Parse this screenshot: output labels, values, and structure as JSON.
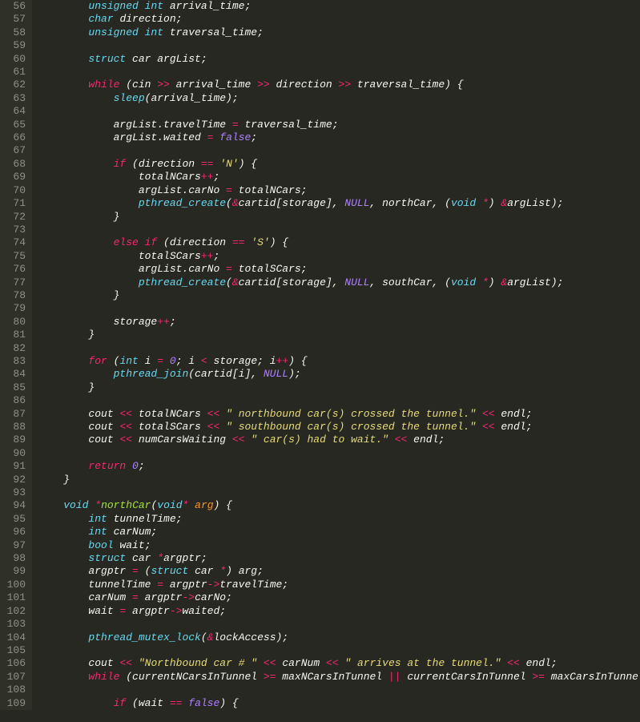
{
  "startLine": 56,
  "lines": [
    {
      "indent": 2,
      "tokens": [
        [
          "type",
          "unsigned int"
        ],
        [
          "plain",
          " arrival_time;"
        ]
      ]
    },
    {
      "indent": 2,
      "tokens": [
        [
          "type",
          "char"
        ],
        [
          "plain",
          " direction;"
        ]
      ]
    },
    {
      "indent": 2,
      "tokens": [
        [
          "type",
          "unsigned int"
        ],
        [
          "plain",
          " traversal_time;"
        ]
      ]
    },
    {
      "indent": 0,
      "tokens": []
    },
    {
      "indent": 2,
      "tokens": [
        [
          "type",
          "struct"
        ],
        [
          "plain",
          " car argList;"
        ]
      ]
    },
    {
      "indent": 0,
      "tokens": []
    },
    {
      "indent": 2,
      "tokens": [
        [
          "kw",
          "while"
        ],
        [
          "plain",
          " (cin "
        ],
        [
          "op",
          ">>"
        ],
        [
          "plain",
          " arrival_time "
        ],
        [
          "op",
          ">>"
        ],
        [
          "plain",
          " direction "
        ],
        [
          "op",
          ">>"
        ],
        [
          "plain",
          " traversal_time) {"
        ]
      ]
    },
    {
      "indent": 3,
      "tokens": [
        [
          "func",
          "sleep"
        ],
        [
          "plain",
          "(arrival_time);"
        ]
      ]
    },
    {
      "indent": 0,
      "tokens": []
    },
    {
      "indent": 3,
      "tokens": [
        [
          "plain",
          "argList.travelTime "
        ],
        [
          "op",
          "="
        ],
        [
          "plain",
          " traversal_time;"
        ]
      ]
    },
    {
      "indent": 3,
      "tokens": [
        [
          "plain",
          "argList.waited "
        ],
        [
          "op",
          "="
        ],
        [
          "plain",
          " "
        ],
        [
          "num",
          "false"
        ],
        [
          "plain",
          ";"
        ]
      ]
    },
    {
      "indent": 0,
      "tokens": []
    },
    {
      "indent": 3,
      "tokens": [
        [
          "kw",
          "if"
        ],
        [
          "plain",
          " (direction "
        ],
        [
          "op",
          "=="
        ],
        [
          "plain",
          " "
        ],
        [
          "str",
          "'N'"
        ],
        [
          "plain",
          ") {"
        ]
      ]
    },
    {
      "indent": 4,
      "tokens": [
        [
          "plain",
          "totalNCars"
        ],
        [
          "op",
          "++"
        ],
        [
          "plain",
          ";"
        ]
      ]
    },
    {
      "indent": 4,
      "tokens": [
        [
          "plain",
          "argList.carNo "
        ],
        [
          "op",
          "="
        ],
        [
          "plain",
          " totalNCars;"
        ]
      ]
    },
    {
      "indent": 4,
      "tokens": [
        [
          "func",
          "pthread_create"
        ],
        [
          "plain",
          "("
        ],
        [
          "op",
          "&"
        ],
        [
          "plain",
          "cartid[storage], "
        ],
        [
          "num",
          "NULL"
        ],
        [
          "plain",
          ", northCar, ("
        ],
        [
          "type",
          "void"
        ],
        [
          "plain",
          " "
        ],
        [
          "op",
          "*"
        ],
        [
          "plain",
          ") "
        ],
        [
          "op",
          "&"
        ],
        [
          "plain",
          "argList);"
        ]
      ]
    },
    {
      "indent": 3,
      "tokens": [
        [
          "plain",
          "}"
        ]
      ]
    },
    {
      "indent": 0,
      "tokens": []
    },
    {
      "indent": 3,
      "tokens": [
        [
          "kw",
          "else if"
        ],
        [
          "plain",
          " (direction "
        ],
        [
          "op",
          "=="
        ],
        [
          "plain",
          " "
        ],
        [
          "str",
          "'S'"
        ],
        [
          "plain",
          ") {"
        ]
      ]
    },
    {
      "indent": 4,
      "tokens": [
        [
          "plain",
          "totalSCars"
        ],
        [
          "op",
          "++"
        ],
        [
          "plain",
          ";"
        ]
      ]
    },
    {
      "indent": 4,
      "tokens": [
        [
          "plain",
          "argList.carNo "
        ],
        [
          "op",
          "="
        ],
        [
          "plain",
          " totalSCars;"
        ]
      ]
    },
    {
      "indent": 4,
      "tokens": [
        [
          "func",
          "pthread_create"
        ],
        [
          "plain",
          "("
        ],
        [
          "op",
          "&"
        ],
        [
          "plain",
          "cartid[storage], "
        ],
        [
          "num",
          "NULL"
        ],
        [
          "plain",
          ", southCar, ("
        ],
        [
          "type",
          "void"
        ],
        [
          "plain",
          " "
        ],
        [
          "op",
          "*"
        ],
        [
          "plain",
          ") "
        ],
        [
          "op",
          "&"
        ],
        [
          "plain",
          "argList);"
        ]
      ]
    },
    {
      "indent": 3,
      "tokens": [
        [
          "plain",
          "}"
        ]
      ]
    },
    {
      "indent": 0,
      "tokens": []
    },
    {
      "indent": 3,
      "tokens": [
        [
          "plain",
          "storage"
        ],
        [
          "op",
          "++"
        ],
        [
          "plain",
          ";"
        ]
      ]
    },
    {
      "indent": 2,
      "tokens": [
        [
          "plain",
          "}"
        ]
      ]
    },
    {
      "indent": 0,
      "tokens": []
    },
    {
      "indent": 2,
      "tokens": [
        [
          "kw",
          "for"
        ],
        [
          "plain",
          " ("
        ],
        [
          "type",
          "int"
        ],
        [
          "plain",
          " i "
        ],
        [
          "op",
          "="
        ],
        [
          "plain",
          " "
        ],
        [
          "num",
          "0"
        ],
        [
          "plain",
          "; i "
        ],
        [
          "op",
          "<"
        ],
        [
          "plain",
          " storage; i"
        ],
        [
          "op",
          "++"
        ],
        [
          "plain",
          ") {"
        ]
      ]
    },
    {
      "indent": 3,
      "tokens": [
        [
          "func",
          "pthread_join"
        ],
        [
          "plain",
          "(cartid[i], "
        ],
        [
          "num",
          "NULL"
        ],
        [
          "plain",
          ");"
        ]
      ]
    },
    {
      "indent": 2,
      "tokens": [
        [
          "plain",
          "}"
        ]
      ]
    },
    {
      "indent": 0,
      "tokens": []
    },
    {
      "indent": 2,
      "tokens": [
        [
          "plain",
          "cout "
        ],
        [
          "op",
          "<<"
        ],
        [
          "plain",
          " totalNCars "
        ],
        [
          "op",
          "<<"
        ],
        [
          "plain",
          " "
        ],
        [
          "str",
          "\" northbound car(s) crossed the tunnel.\""
        ],
        [
          "plain",
          " "
        ],
        [
          "op",
          "<<"
        ],
        [
          "plain",
          " endl;"
        ]
      ]
    },
    {
      "indent": 2,
      "tokens": [
        [
          "plain",
          "cout "
        ],
        [
          "op",
          "<<"
        ],
        [
          "plain",
          " totalSCars "
        ],
        [
          "op",
          "<<"
        ],
        [
          "plain",
          " "
        ],
        [
          "str",
          "\" southbound car(s) crossed the tunnel.\""
        ],
        [
          "plain",
          " "
        ],
        [
          "op",
          "<<"
        ],
        [
          "plain",
          " endl;"
        ]
      ]
    },
    {
      "indent": 2,
      "tokens": [
        [
          "plain",
          "cout "
        ],
        [
          "op",
          "<<"
        ],
        [
          "plain",
          " numCarsWaiting "
        ],
        [
          "op",
          "<<"
        ],
        [
          "plain",
          " "
        ],
        [
          "str",
          "\" car(s) had to wait.\""
        ],
        [
          "plain",
          " "
        ],
        [
          "op",
          "<<"
        ],
        [
          "plain",
          " endl;"
        ]
      ]
    },
    {
      "indent": 0,
      "tokens": []
    },
    {
      "indent": 2,
      "tokens": [
        [
          "kw",
          "return"
        ],
        [
          "plain",
          " "
        ],
        [
          "num",
          "0"
        ],
        [
          "plain",
          ";"
        ]
      ]
    },
    {
      "indent": 1,
      "tokens": [
        [
          "plain",
          "}"
        ]
      ]
    },
    {
      "indent": 0,
      "tokens": []
    },
    {
      "indent": 1,
      "tokens": [
        [
          "type",
          "void"
        ],
        [
          "plain",
          " "
        ],
        [
          "op",
          "*"
        ],
        [
          "fn",
          "northCar"
        ],
        [
          "plain",
          "("
        ],
        [
          "type",
          "void"
        ],
        [
          "op",
          "*"
        ],
        [
          "plain",
          " "
        ],
        [
          "param",
          "arg"
        ],
        [
          "plain",
          ") {"
        ]
      ]
    },
    {
      "indent": 2,
      "tokens": [
        [
          "type",
          "int"
        ],
        [
          "plain",
          " tunnelTime;"
        ]
      ]
    },
    {
      "indent": 2,
      "tokens": [
        [
          "type",
          "int"
        ],
        [
          "plain",
          " carNum;"
        ]
      ]
    },
    {
      "indent": 2,
      "tokens": [
        [
          "type",
          "bool"
        ],
        [
          "plain",
          " wait;"
        ]
      ]
    },
    {
      "indent": 2,
      "tokens": [
        [
          "type",
          "struct"
        ],
        [
          "plain",
          " car "
        ],
        [
          "op",
          "*"
        ],
        [
          "plain",
          "argptr;"
        ]
      ]
    },
    {
      "indent": 2,
      "tokens": [
        [
          "plain",
          "argptr "
        ],
        [
          "op",
          "="
        ],
        [
          "plain",
          " ("
        ],
        [
          "type",
          "struct"
        ],
        [
          "plain",
          " car "
        ],
        [
          "op",
          "*"
        ],
        [
          "plain",
          ") arg;"
        ]
      ]
    },
    {
      "indent": 2,
      "tokens": [
        [
          "plain",
          "tunnelTime "
        ],
        [
          "op",
          "="
        ],
        [
          "plain",
          " argptr"
        ],
        [
          "op",
          "->"
        ],
        [
          "plain",
          "travelTime;"
        ]
      ]
    },
    {
      "indent": 2,
      "tokens": [
        [
          "plain",
          "carNum "
        ],
        [
          "op",
          "="
        ],
        [
          "plain",
          " argptr"
        ],
        [
          "op",
          "->"
        ],
        [
          "plain",
          "carNo;"
        ]
      ]
    },
    {
      "indent": 2,
      "tokens": [
        [
          "plain",
          "wait "
        ],
        [
          "op",
          "="
        ],
        [
          "plain",
          " argptr"
        ],
        [
          "op",
          "->"
        ],
        [
          "plain",
          "waited;"
        ]
      ]
    },
    {
      "indent": 0,
      "tokens": []
    },
    {
      "indent": 2,
      "tokens": [
        [
          "func",
          "pthread_mutex_lock"
        ],
        [
          "plain",
          "("
        ],
        [
          "op",
          "&"
        ],
        [
          "plain",
          "lockAccess);"
        ]
      ]
    },
    {
      "indent": 0,
      "tokens": []
    },
    {
      "indent": 2,
      "tokens": [
        [
          "plain",
          "cout "
        ],
        [
          "op",
          "<<"
        ],
        [
          "plain",
          " "
        ],
        [
          "str",
          "\"Northbound car # \""
        ],
        [
          "plain",
          " "
        ],
        [
          "op",
          "<<"
        ],
        [
          "plain",
          " carNum "
        ],
        [
          "op",
          "<<"
        ],
        [
          "plain",
          " "
        ],
        [
          "str",
          "\" arrives at the tunnel.\""
        ],
        [
          "plain",
          " "
        ],
        [
          "op",
          "<<"
        ],
        [
          "plain",
          " endl;"
        ]
      ]
    },
    {
      "indent": 2,
      "tokens": [
        [
          "kw",
          "while"
        ],
        [
          "plain",
          " (currentNCarsInTunnel "
        ],
        [
          "op",
          ">="
        ],
        [
          "plain",
          " maxNCarsInTunnel "
        ],
        [
          "op",
          "||"
        ],
        [
          "plain",
          " currentCarsInTunnel "
        ],
        [
          "op",
          ">="
        ],
        [
          "plain",
          " maxCarsInTunnel) {"
        ]
      ]
    },
    {
      "indent": 0,
      "tokens": []
    },
    {
      "indent": 3,
      "tokens": [
        [
          "kw",
          "if"
        ],
        [
          "plain",
          " (wait "
        ],
        [
          "op",
          "=="
        ],
        [
          "plain",
          " "
        ],
        [
          "num",
          "false"
        ],
        [
          "plain",
          ") {"
        ]
      ]
    }
  ]
}
